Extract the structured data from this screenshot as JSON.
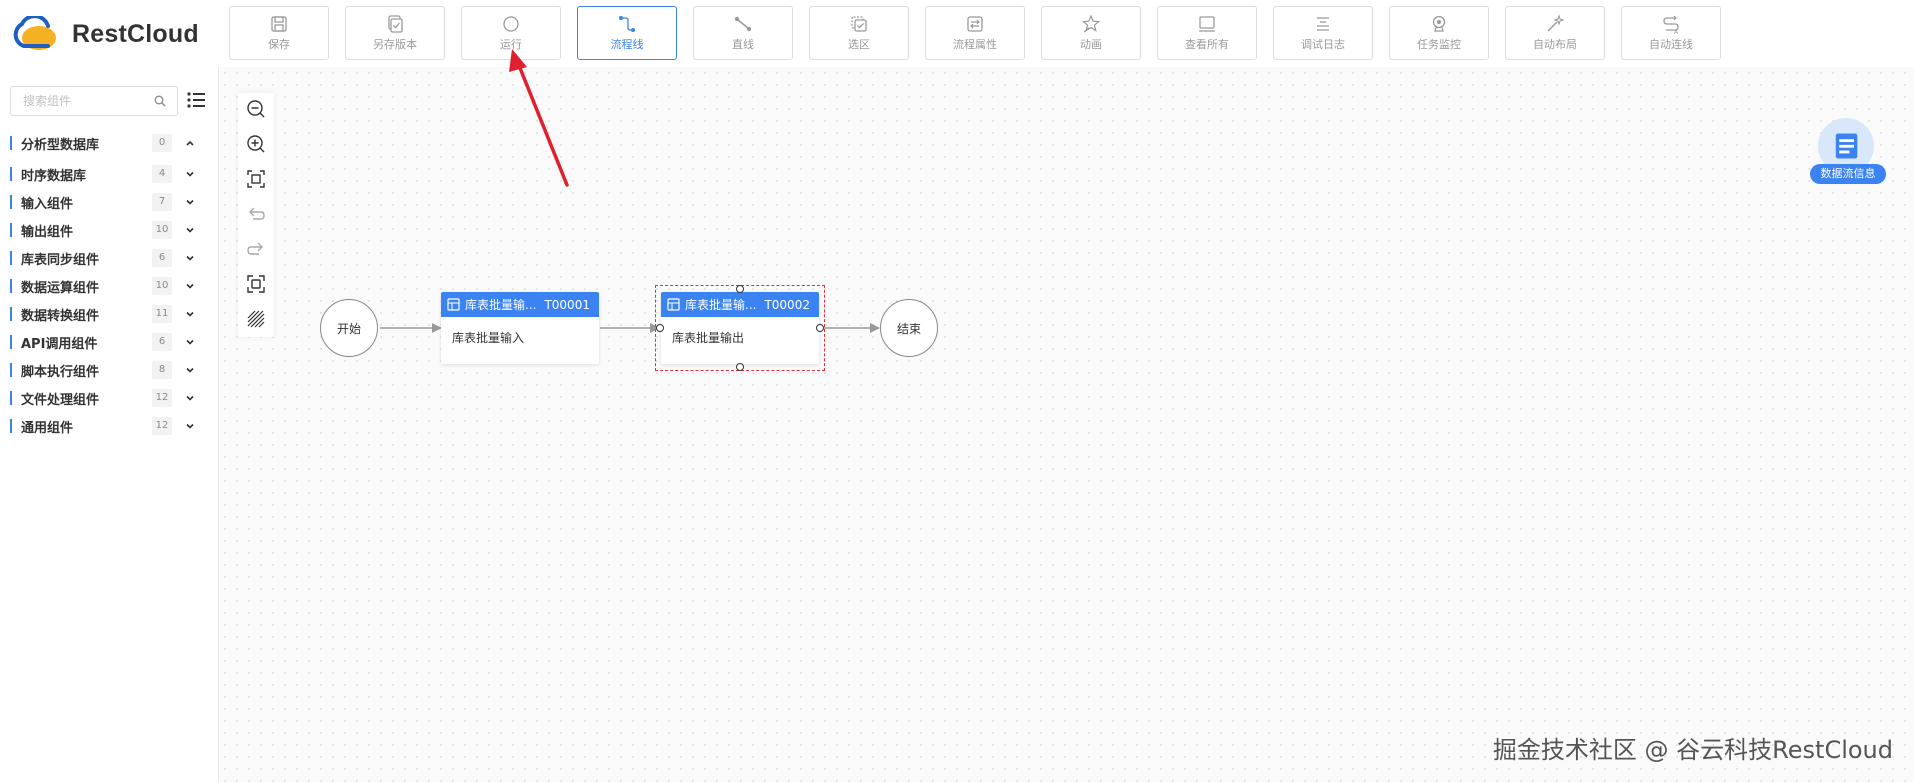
{
  "app": {
    "logo_text": "RestCloud"
  },
  "toolbar": {
    "buttons": [
      {
        "label": "保存",
        "icon": "save-icon"
      },
      {
        "label": "另存版本",
        "icon": "save-version-icon"
      },
      {
        "label": "运行",
        "icon": "run-icon"
      },
      {
        "label": "流程线",
        "icon": "flow-line-icon",
        "active": true
      },
      {
        "label": "直线",
        "icon": "straight-line-icon"
      },
      {
        "label": "选区",
        "icon": "selection-icon"
      },
      {
        "label": "流程属性",
        "icon": "flow-properties-icon"
      },
      {
        "label": "动画",
        "icon": "animation-icon"
      },
      {
        "label": "查看所有",
        "icon": "view-all-icon"
      },
      {
        "label": "调试日志",
        "icon": "debug-log-icon"
      },
      {
        "label": "任务监控",
        "icon": "task-monitor-icon"
      },
      {
        "label": "自动布局",
        "icon": "auto-layout-icon"
      },
      {
        "label": "自动连线",
        "icon": "auto-connect-icon"
      }
    ]
  },
  "sidebar": {
    "search": {
      "placeholder": "搜索组件",
      "value": ""
    },
    "categories": [
      {
        "label": "分析型数据库",
        "count": "0",
        "expanded": true
      },
      {
        "label": "时序数据库",
        "count": "4"
      },
      {
        "label": "输入组件",
        "count": "7"
      },
      {
        "label": "输出组件",
        "count": "10"
      },
      {
        "label": "库表同步组件",
        "count": "6"
      },
      {
        "label": "数据运算组件",
        "count": "10"
      },
      {
        "label": "数据转换组件",
        "count": "11"
      },
      {
        "label": "API调用组件",
        "count": "6"
      },
      {
        "label": "脚本执行组件",
        "count": "8"
      },
      {
        "label": "文件处理组件",
        "count": "12"
      },
      {
        "label": "通用组件",
        "count": "12"
      }
    ]
  },
  "canvas": {
    "zoom_tools": [
      "zoom-out-icon",
      "zoom-in-icon",
      "fit-view-icon",
      "undo-icon",
      "redo-icon",
      "fullscreen-icon",
      "grid-toggle-icon"
    ],
    "nodes": {
      "start": {
        "label": "开始"
      },
      "task1": {
        "title": "库表批量输...",
        "id": "T00001",
        "body": "库表批量输入"
      },
      "task2": {
        "title": "库表批量输...",
        "id": "T00002",
        "body": "库表批量输出",
        "selected": true
      },
      "end": {
        "label": "结束"
      }
    },
    "info_badge": {
      "label": "数据流信息"
    }
  },
  "watermark": {
    "text": "掘金技术社区 @ 谷云科技RestCloud"
  },
  "colors": {
    "accent": "#3b83f2",
    "annotation_arrow": "#e0202e",
    "selection": "#e0303a"
  }
}
